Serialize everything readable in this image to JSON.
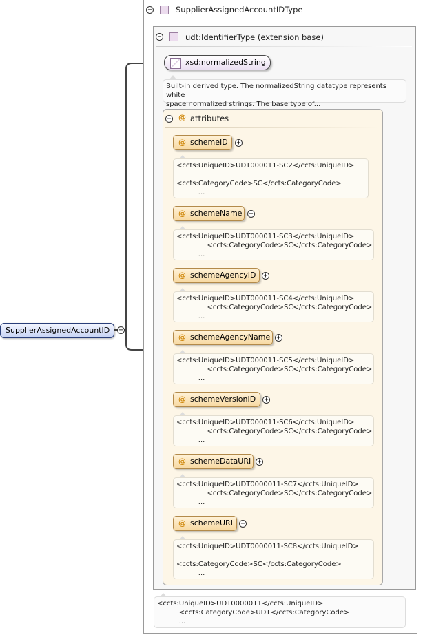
{
  "root_element": {
    "label": "SupplierAssignedAccountID"
  },
  "complex_type": {
    "label": "SupplierAssignedAccountIDType"
  },
  "base_type": {
    "label": "udt:IdentifierType (extension base)"
  },
  "simple_type": {
    "label": "xsd:normalizedString",
    "doc": "Built-in derived type. The normalizedString datatype represents white\nspace normalized strings. The base type of..."
  },
  "attributes_group": {
    "label": "attributes"
  },
  "attributes": [
    {
      "label": "schemeID",
      "doc": "<ccts:UniqueID>UDT000011-SC2</ccts:UniqueID>\n\n<ccts:CategoryCode>SC</ccts:CategoryCode>\n          ..."
    },
    {
      "label": "schemeName",
      "doc": "<ccts:UniqueID>UDT000011-SC3</ccts:UniqueID>\n              <ccts:CategoryCode>SC</ccts:CategoryCode>\n          ..."
    },
    {
      "label": "schemeAgencyID",
      "doc": "<ccts:UniqueID>UDT000011-SC4</ccts:UniqueID>\n              <ccts:CategoryCode>SC</ccts:CategoryCode>\n          ..."
    },
    {
      "label": "schemeAgencyName",
      "doc": "<ccts:UniqueID>UDT000011-SC5</ccts:UniqueID>\n              <ccts:CategoryCode>SC</ccts:CategoryCode>\n          ..."
    },
    {
      "label": "schemeVersionID",
      "doc": "<ccts:UniqueID>UDT000011-SC6</ccts:UniqueID>\n              <ccts:CategoryCode>SC</ccts:CategoryCode>\n          ..."
    },
    {
      "label": "schemeDataURI",
      "doc": "<ccts:UniqueID>UDT0000011-SC7</ccts:UniqueID>\n              <ccts:CategoryCode>SC</ccts:CategoryCode>\n          ..."
    },
    {
      "label": "schemeURI",
      "doc": "<ccts:UniqueID>UDT0000011-SC8</ccts:UniqueID>\n\n<ccts:CategoryCode>SC</ccts:CategoryCode>\n          ..."
    }
  ],
  "type_doc": "<ccts:UniqueID>UDT0000011</ccts:UniqueID>\n          <ccts:CategoryCode>UDT</ccts:CategoryCode>\n          ...",
  "icons": {
    "collapse": "−",
    "expand": "+",
    "attribute": "@"
  }
}
